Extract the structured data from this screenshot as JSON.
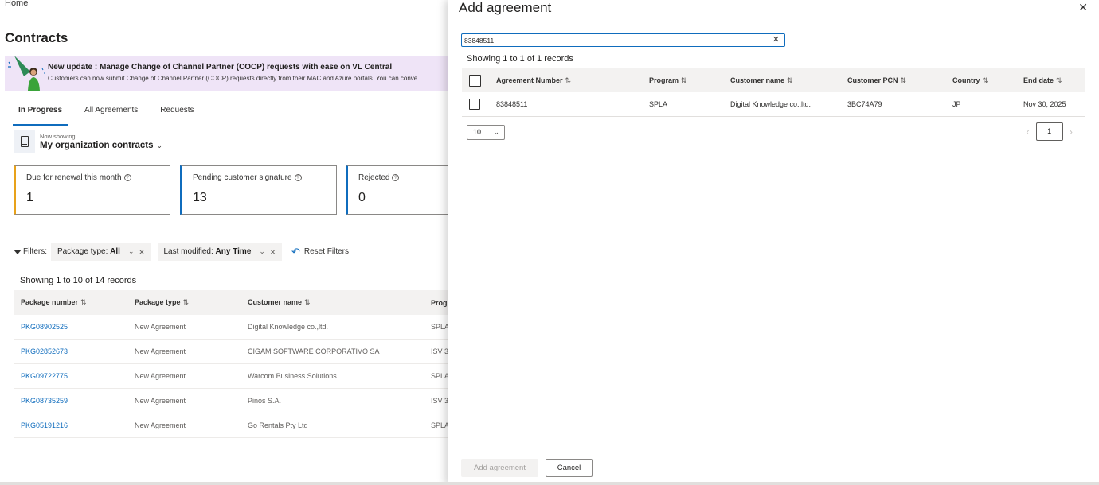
{
  "breadcrumb": "Home",
  "page_title": "Contracts",
  "banner": {
    "title": "New update : Manage Change of Channel Partner (COCP) requests with ease on VL Central",
    "text": "Customers can now submit Change of Channel Partner (COCP) requests directly from their MAC and Azure portals. You can conve"
  },
  "tabs": [
    {
      "label": "In Progress",
      "active": true
    },
    {
      "label": "All Agreements",
      "active": false
    },
    {
      "label": "Requests",
      "active": false
    }
  ],
  "now_showing": {
    "label": "Now showing",
    "value": "My organization contracts"
  },
  "stats": [
    {
      "label": "Due for renewal this month",
      "value": "1",
      "accent": "#e8a21a"
    },
    {
      "label": "Pending customer signature",
      "value": "13",
      "accent": "#0f6cbd"
    },
    {
      "label": "Rejected",
      "value": "0",
      "accent": "#0f6cbd"
    }
  ],
  "filters": {
    "label": "Filters:",
    "package_type": {
      "name": "Package type:",
      "value": "All"
    },
    "last_modified": {
      "name": "Last modified:",
      "value": "Any Time"
    },
    "reset": "Reset Filters"
  },
  "bg_table": {
    "records": "Showing 1 to 10 of 14 records",
    "headers": [
      "Package number",
      "Package type",
      "Customer name",
      "Prog"
    ],
    "rows": [
      [
        "PKG08902525",
        "New Agreement",
        "Digital Knowledge co.,ltd.",
        "SPLA"
      ],
      [
        "PKG02852673",
        "New Agreement",
        "CIGAM SOFTWARE CORPORATIVO SA",
        "ISV 3"
      ],
      [
        "PKG09722775",
        "New Agreement",
        "Warcom Business Solutions",
        "SPLA"
      ],
      [
        "PKG08735259",
        "New Agreement",
        "Pinos S.A.",
        "ISV 3"
      ],
      [
        "PKG05191216",
        "New Agreement",
        "Go Rentals Pty Ltd",
        "SPLA"
      ]
    ]
  },
  "panel": {
    "title": "Add agreement",
    "search": {
      "value": "83848511",
      "placeholder": ""
    },
    "records": "Showing 1 to 1 of 1 records",
    "headers": [
      "Agreement Number",
      "Program",
      "Customer name",
      "Customer PCN",
      "Country",
      "End date"
    ],
    "rows": [
      [
        "83848511",
        "SPLA",
        "Digital Knowledge co.,ltd.",
        "3BC74A79",
        "JP",
        "Nov 30, 2025"
      ]
    ],
    "page_size": "10",
    "current_page": "1",
    "add_button": "Add agreement",
    "cancel_button": "Cancel"
  },
  "colors": {
    "accent": "#0f6cbd",
    "banner_bg": "#efe4f7"
  }
}
